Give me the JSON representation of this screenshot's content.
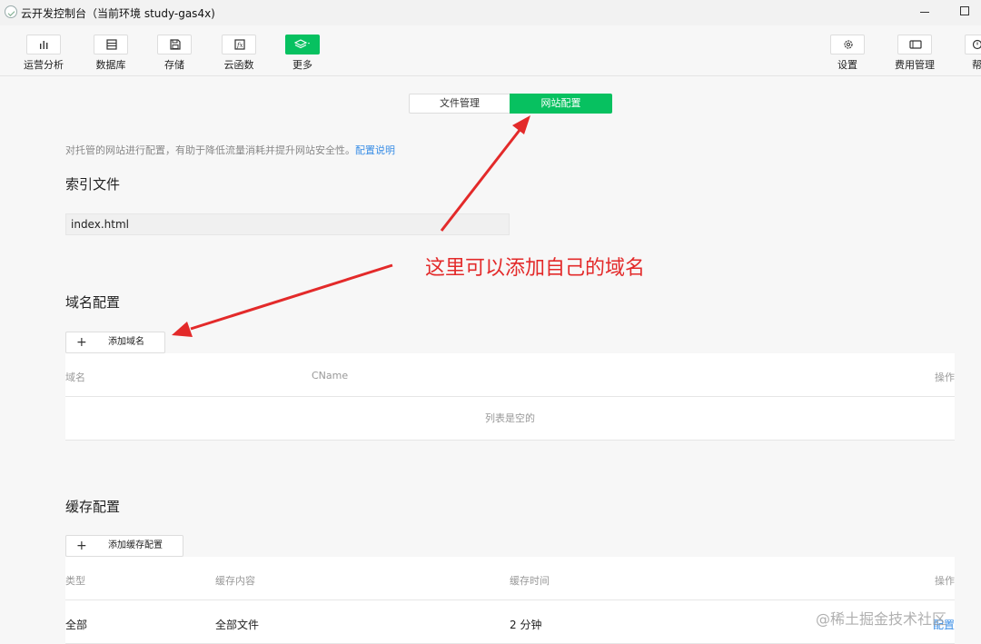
{
  "window": {
    "title": "云开发控制台（当前环境 study-gas4x)"
  },
  "toolbar": {
    "items": [
      {
        "label": "运营分析",
        "icon": "bar-chart-icon"
      },
      {
        "label": "数据库",
        "icon": "database-icon"
      },
      {
        "label": "存储",
        "icon": "save-icon"
      },
      {
        "label": "云函数",
        "icon": "function-icon"
      },
      {
        "label": "更多",
        "icon": "layers-dropdown-icon"
      }
    ],
    "right_items": [
      {
        "label": "设置",
        "icon": "gear-icon"
      },
      {
        "label": "费用管理",
        "icon": "billing-icon"
      },
      {
        "label": "帮",
        "icon": "help-icon"
      }
    ],
    "accent": "#07c160"
  },
  "tabs": {
    "files": "文件管理",
    "site": "网站配置",
    "active": "site"
  },
  "description": {
    "text": "对托管的网站进行配置，有助于降低流量消耗并提升网站安全性。",
    "link": "配置说明"
  },
  "index_file": {
    "title": "索引文件",
    "value": "index.html"
  },
  "domain_config": {
    "title": "域名配置",
    "add_button": "添加域名",
    "columns": [
      "域名",
      "CName",
      "操作"
    ],
    "empty_text": "列表是空的"
  },
  "cache_config": {
    "title": "缓存配置",
    "add_button": "添加缓存配置",
    "columns": [
      "类型",
      "缓存内容",
      "缓存时间",
      "操作"
    ],
    "rows": [
      {
        "type": "全部",
        "content": "全部文件",
        "time": "2 分钟",
        "action": "配置"
      }
    ]
  },
  "annotation": {
    "text": "这里可以添加自己的域名",
    "color": "#e32a2a"
  },
  "watermark": "@稀土掘金技术社区"
}
